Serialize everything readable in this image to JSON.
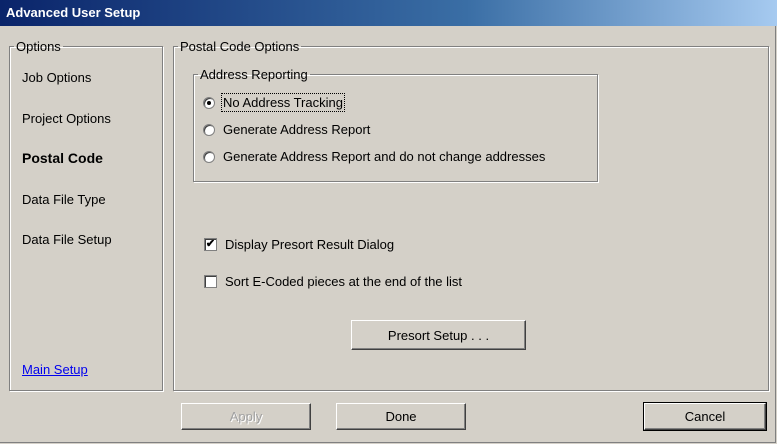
{
  "window": {
    "title": "Advanced User Setup"
  },
  "options": {
    "legend": "Options",
    "items": [
      {
        "label": "Job Options"
      },
      {
        "label": "Project Options"
      },
      {
        "label": "Postal Code"
      },
      {
        "label": "Data File Type"
      },
      {
        "label": "Data File Setup"
      }
    ],
    "selected": "Postal Code",
    "main_setup_link": "Main Setup"
  },
  "postal": {
    "legend": "Postal Code Options",
    "address_reporting": {
      "legend": "Address Reporting",
      "options": [
        {
          "label": "No Address Tracking",
          "selected": true
        },
        {
          "label": "Generate Address Report",
          "selected": false
        },
        {
          "label": "Generate Address Report and do not change addresses",
          "selected": false
        }
      ]
    },
    "checkboxes": [
      {
        "label": "Display Presort Result Dialog",
        "checked": true
      },
      {
        "label": "Sort E-Coded pieces at the end of the list",
        "checked": false
      }
    ],
    "presort_button": "Presort Setup . . ."
  },
  "footer": {
    "apply": "Apply",
    "done": "Done",
    "cancel": "Cancel"
  }
}
